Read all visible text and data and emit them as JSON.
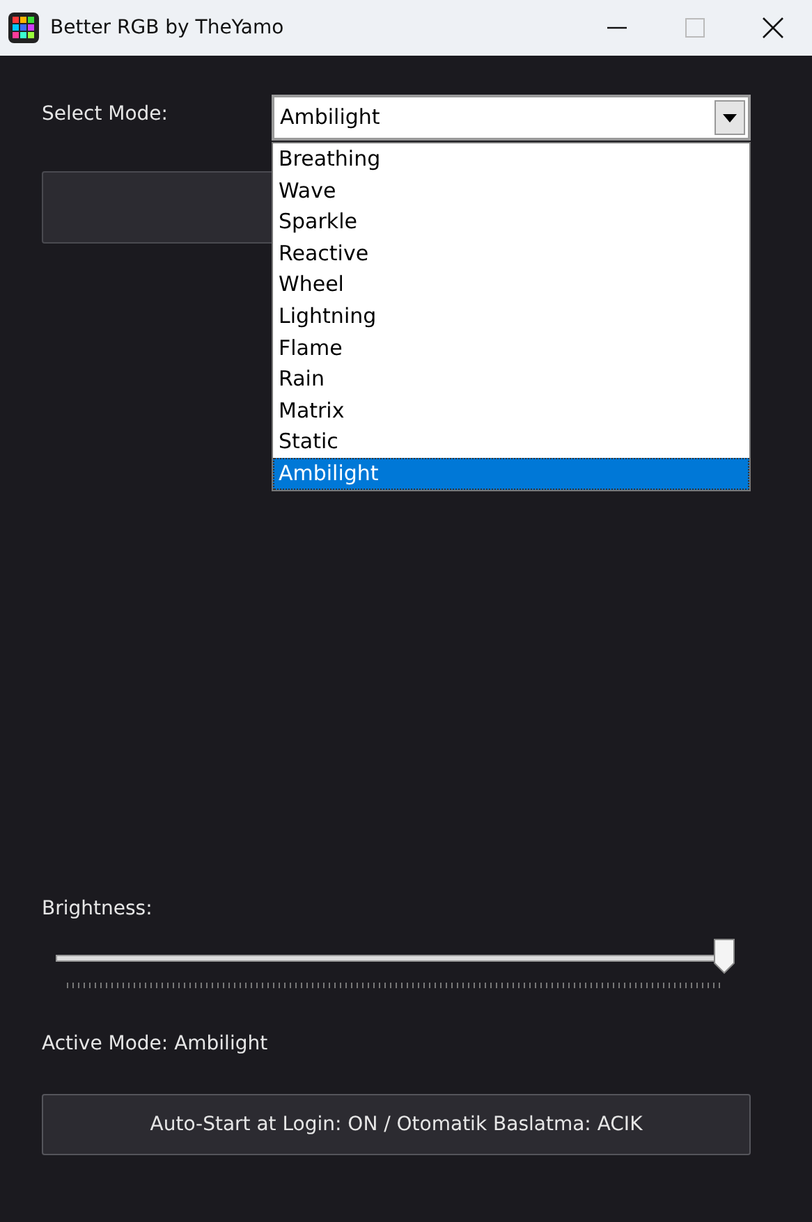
{
  "window": {
    "title": "Better RGB by TheYamo"
  },
  "mode_select": {
    "label": "Select Mode:",
    "value": "Ambilight",
    "expanded": true,
    "options": [
      {
        "label": "Breathing",
        "selected": false
      },
      {
        "label": "Wave",
        "selected": false
      },
      {
        "label": "Sparkle",
        "selected": false
      },
      {
        "label": "Reactive",
        "selected": false
      },
      {
        "label": "Wheel",
        "selected": false
      },
      {
        "label": "Lightning",
        "selected": false
      },
      {
        "label": "Flame",
        "selected": false
      },
      {
        "label": "Rain",
        "selected": false
      },
      {
        "label": "Matrix",
        "selected": false
      },
      {
        "label": "Static",
        "selected": false
      },
      {
        "label": "Ambilight",
        "selected": true
      }
    ]
  },
  "brightness": {
    "label": "Brightness:",
    "level": 1.0
  },
  "active_mode": "Active Mode: Ambilight",
  "autostart_button": "Auto-Start at Login: ON / Otomatik Baslatma: ACIK"
}
